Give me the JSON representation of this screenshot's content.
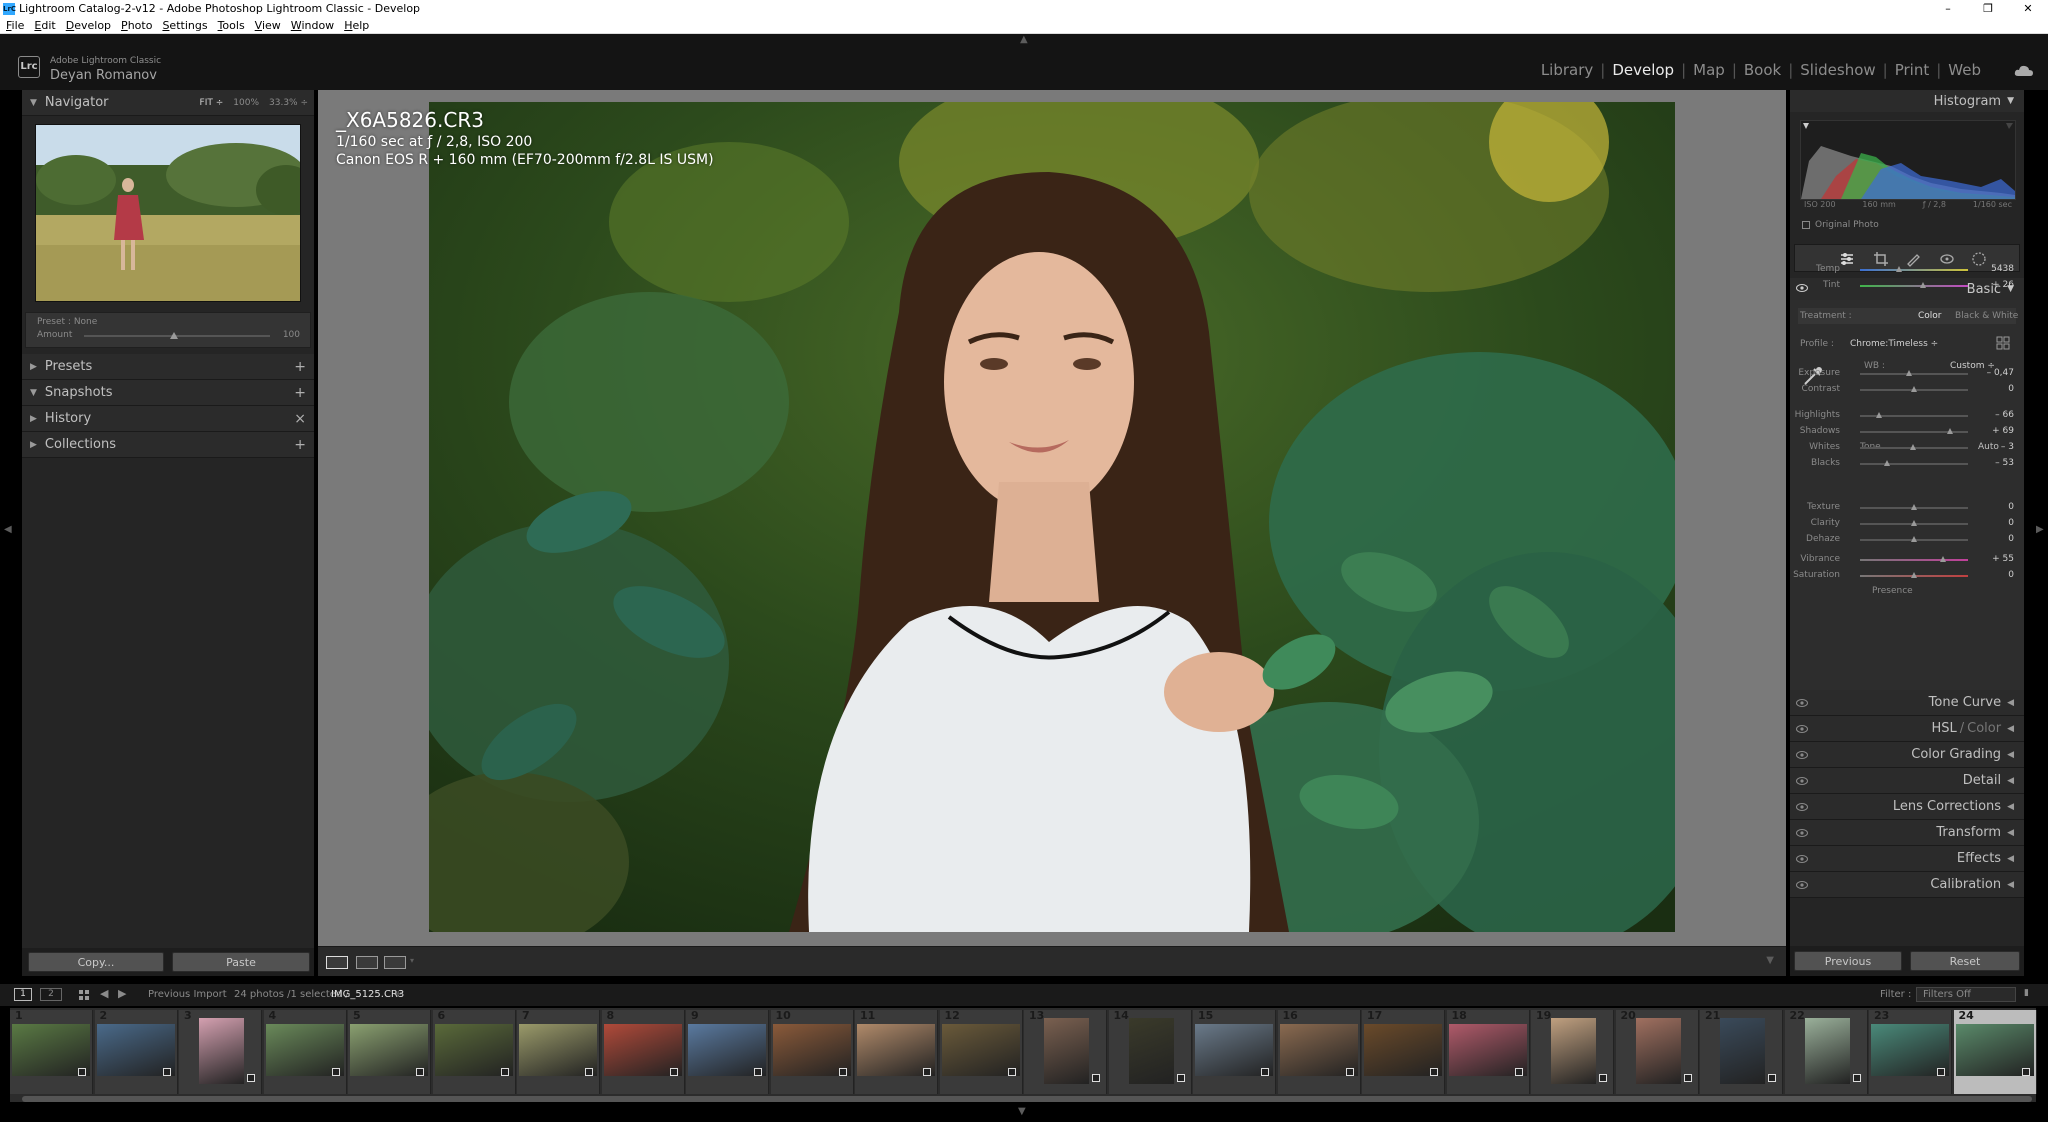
{
  "window": {
    "title": "Lightroom Catalog-2-v12 - Adobe Photoshop Lightroom Classic - Develop",
    "app_icon": "LrC",
    "minimize": "–",
    "maximize": "❐",
    "close": "✕"
  },
  "menu": [
    "File",
    "Edit",
    "Develop",
    "Photo",
    "Settings",
    "Tools",
    "View",
    "Window",
    "Help"
  ],
  "identity": {
    "logo": "Lrc",
    "app_name": "Adobe Lightroom Classic",
    "user": "Deyan Romanov"
  },
  "modules": [
    "Library",
    "Develop",
    "Map",
    "Book",
    "Slideshow",
    "Print",
    "Web"
  ],
  "active_module": "Develop",
  "left": {
    "navigator": {
      "title": "Navigator",
      "zoom": [
        "FIT ÷",
        "100%",
        "33.3% ÷"
      ]
    },
    "preset": {
      "label": "Preset : None",
      "amount_label": "Amount",
      "amount_value": "100",
      "amount_fraction": 0.48
    },
    "panels": [
      {
        "name": "Presets",
        "action": "+"
      },
      {
        "name": "Snapshots",
        "action": "+"
      },
      {
        "name": "History",
        "action": "×"
      },
      {
        "name": "Collections",
        "action": "+"
      }
    ],
    "copy_button": "Copy...",
    "paste_button": "Paste"
  },
  "photo": {
    "filename": "_X6A5826.CR3",
    "exposure_line": "1/160 sec at ƒ / 2,8, ISO 200",
    "camera_line": "Canon EOS R + 160 mm (EF70-200mm f/2.8L IS USM)"
  },
  "right": {
    "histogram": {
      "title": "Histogram",
      "iso": "ISO 200",
      "focal": "160 mm",
      "aperture": "ƒ / 2,8",
      "shutter": "1/160 sec",
      "original_photo": "Original Photo"
    },
    "basic": {
      "title": "Basic",
      "treatment_label": "Treatment :",
      "treatment_color": "Color",
      "treatment_bw": "Black & White",
      "profile_label": "Profile :",
      "profile_value": "Chrome:Timeless ÷",
      "wb_label": "WB :",
      "wb_value": "Custom ÷",
      "tone_label": "Tone",
      "auto_label": "Auto",
      "presence_label": "Presence",
      "sliders": [
        {
          "name": "Temp",
          "value": "5438",
          "pos": 0.36
        },
        {
          "name": "Tint",
          "value": "+ 26",
          "pos": 0.58
        },
        {
          "name": "Exposure",
          "value": "– 0,47",
          "pos": 0.45
        },
        {
          "name": "Contrast",
          "value": "0",
          "pos": 0.5
        },
        {
          "name": "Highlights",
          "value": "– 66",
          "pos": 0.18
        },
        {
          "name": "Shadows",
          "value": "+ 69",
          "pos": 0.83
        },
        {
          "name": "Whites",
          "value": "– 3",
          "pos": 0.49
        },
        {
          "name": "Blacks",
          "value": "– 53",
          "pos": 0.25
        },
        {
          "name": "Texture",
          "value": "0",
          "pos": 0.5
        },
        {
          "name": "Clarity",
          "value": "0",
          "pos": 0.5
        },
        {
          "name": "Dehaze",
          "value": "0",
          "pos": 0.5
        },
        {
          "name": "Vibrance",
          "value": "+ 55",
          "pos": 0.77
        },
        {
          "name": "Saturation",
          "value": "0",
          "pos": 0.5
        }
      ]
    },
    "collapsed_panels": [
      "Tone Curve",
      "HSL",
      "Color",
      "Color Grading",
      "Detail",
      "Lens Corrections",
      "Transform",
      "Effects",
      "Calibration"
    ],
    "previous_button": "Previous",
    "reset_button": "Reset"
  },
  "filmstrip_bar": {
    "source": "Previous Import",
    "count": "24 photos /1 selected /",
    "selected_file": "IMG_5125.CR3",
    "dropdown": "÷",
    "filter_label": "Filter :",
    "filter_value": "Filters Off"
  },
  "filmstrip": [
    "1",
    "2",
    "3",
    "4",
    "5",
    "6",
    "7",
    "8",
    "9",
    "10",
    "11",
    "12",
    "13",
    "14",
    "15",
    "16",
    "17",
    "18",
    "19",
    "20",
    "21",
    "22",
    "23",
    "24"
  ],
  "colors": {
    "panel_bg": "#252525",
    "center_bg": "#7a7a7a",
    "active_module": "#eaeaea"
  }
}
